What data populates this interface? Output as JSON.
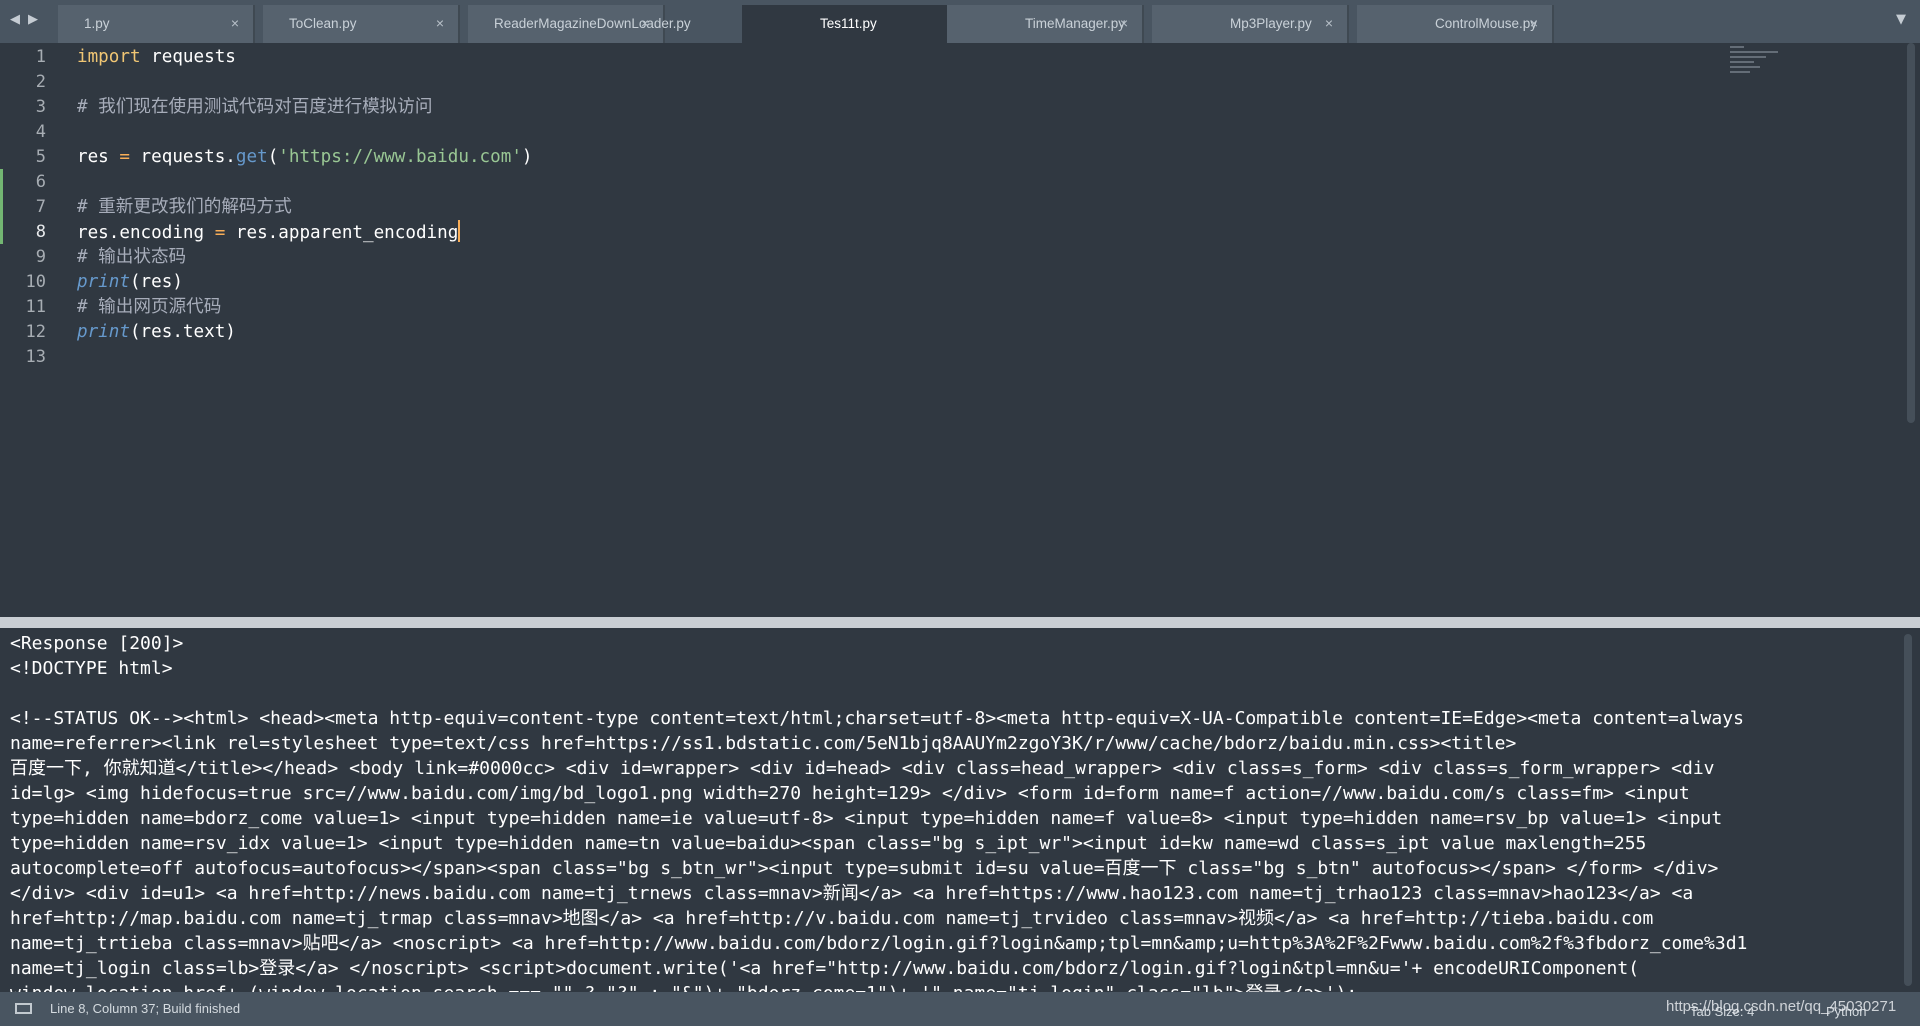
{
  "nav": {
    "back": "◀",
    "forward": "▶"
  },
  "tabs": [
    {
      "label": "1.py",
      "close": "×"
    },
    {
      "label": "ToClean.py",
      "close": "×"
    },
    {
      "label": "ReaderMagazineDownLoader.py",
      "close": "×"
    },
    {
      "label": "Tes11t.py",
      "close": "×",
      "active": true
    },
    {
      "label": "TimeManager.py",
      "close": "×"
    },
    {
      "label": "Mp3Player.py",
      "close": "×"
    },
    {
      "label": "ControlMouse.py",
      "close": "×"
    }
  ],
  "tab_dropdown": "▼",
  "editor": {
    "line_numbers": [
      "1",
      "2",
      "3",
      "4",
      "5",
      "6",
      "7",
      "8",
      "9",
      "10",
      "11",
      "12",
      "13"
    ],
    "current_line": 8,
    "lines": {
      "l1": {
        "kw": "import",
        "rest": " requests"
      },
      "l3": {
        "comment": "# 我们现在使用测试代码对百度进行模拟访问"
      },
      "l5": {
        "a": "res ",
        "op": "=",
        "b": " requests.",
        "fn": "get",
        "c": "(",
        "str": "'https://www.baidu.com'",
        "d": ")"
      },
      "l7": {
        "comment": "# 重新更改我们的解码方式"
      },
      "l8": {
        "a": "res.encoding ",
        "op": "=",
        "b": " res.apparent_encoding"
      },
      "l9": {
        "comment": "# 输出状态码"
      },
      "l10": {
        "fn": "print",
        "rest": "(res)"
      },
      "l11": {
        "comment": "# 输出网页源代码"
      },
      "l12": {
        "fn": "print",
        "rest": "(res.text)"
      }
    }
  },
  "output": {
    "lines": [
      "<Response [200]>",
      "<!DOCTYPE html>",
      "",
      "<!--STATUS OK--><html> <head><meta http-equiv=content-type content=text/html;charset=utf-8><meta http-equiv=X-UA-Compatible content=IE=Edge><meta content=always",
      "name=referrer><link rel=stylesheet type=text/css href=https://ss1.bdstatic.com/5eN1bjq8AAUYm2zgoY3K/r/www/cache/bdorz/baidu.min.css><title>",
      "百度一下, 你就知道</title></head> <body link=#0000cc> <div id=wrapper> <div id=head> <div class=head_wrapper> <div class=s_form> <div class=s_form_wrapper> <div",
      "id=lg> <img hidefocus=true src=//www.baidu.com/img/bd_logo1.png width=270 height=129> </div> <form id=form name=f action=//www.baidu.com/s class=fm> <input",
      "type=hidden name=bdorz_come value=1> <input type=hidden name=ie value=utf-8> <input type=hidden name=f value=8> <input type=hidden name=rsv_bp value=1> <input",
      "type=hidden name=rsv_idx value=1> <input type=hidden name=tn value=baidu><span class=\"bg s_ipt_wr\"><input id=kw name=wd class=s_ipt value maxlength=255",
      "autocomplete=off autofocus=autofocus></span><span class=\"bg s_btn_wr\"><input type=submit id=su value=百度一下 class=\"bg s_btn\" autofocus></span> </form> </div>",
      "</div> <div id=u1> <a href=http://news.baidu.com name=tj_trnews class=mnav>新闻</a> <a href=https://www.hao123.com name=tj_trhao123 class=mnav>hao123</a> <a",
      "href=http://map.baidu.com name=tj_trmap class=mnav>地图</a> <a href=http://v.baidu.com name=tj_trvideo class=mnav>视频</a> <a href=http://tieba.baidu.com",
      "name=tj_trtieba class=mnav>贴吧</a> <noscript> <a href=http://www.baidu.com/bdorz/login.gif?login&amp;tpl=mn&amp;u=http%3A%2F%2Fwww.baidu.com%2f%3fbdorz_come%3d1",
      "name=tj_login class=lb>登录</a> </noscript> <script>document.write('<a href=\"http://www.baidu.com/bdorz/login.gif?login&tpl=mn&u='+ encodeURIComponent(",
      "window.location.href+ (window.location.search === \"\" ? \"?\" : \"&\")+ \"bdorz_come=1\")+ '\" name=\"tj_login\" class=\"lb\">登录</a>');"
    ]
  },
  "statusbar": {
    "text": "Line 8, Column 37; Build finished",
    "tab_size": "Tab Size: 4",
    "syntax": "Python",
    "watermark": "https://blog.csdn.net/qq_45030271"
  }
}
